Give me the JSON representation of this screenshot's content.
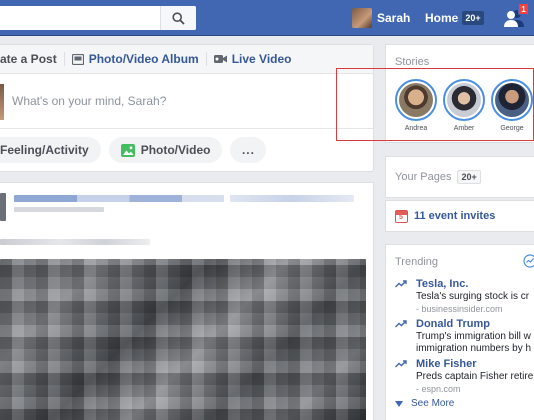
{
  "topbar": {
    "user_name": "Sarah",
    "home_label": "Home",
    "home_count": "20+",
    "friend_requests_count": "1"
  },
  "composer": {
    "tabs": [
      {
        "label": "ate a Post",
        "icon": "pencil-icon"
      },
      {
        "label": "Photo/Video Album",
        "icon": "album-icon"
      },
      {
        "label": "Live Video",
        "icon": "video-camera-icon"
      }
    ],
    "placeholder": "What's on your mind, Sarah?",
    "actions": [
      {
        "label": "Feeling/Activity"
      },
      {
        "label": "Photo/Video",
        "icon": "photo-icon"
      },
      {
        "label": "..."
      }
    ]
  },
  "stories": {
    "title": "Stories",
    "items": [
      {
        "name": "Andrea"
      },
      {
        "name": "Amber"
      },
      {
        "name": "George"
      }
    ]
  },
  "pages": {
    "label": "Your Pages",
    "count": "20+"
  },
  "events": {
    "label": "11 event invites"
  },
  "trending": {
    "title": "Trending",
    "items": [
      {
        "topic": "Tesla, Inc.",
        "desc": "Tesla's surging stock is cr",
        "source": "- businessinsider.com"
      },
      {
        "topic": "Donald Trump",
        "desc": "Trump's immigration bill w",
        "desc2": "immigration numbers by h"
      },
      {
        "topic": "Mike Fisher",
        "desc": "Preds captain Fisher retire",
        "source": "- espn.com"
      }
    ],
    "see_more": "See More"
  },
  "colors": {
    "brand_blue": "#4267b2",
    "link_blue": "#365899",
    "story_ring": "#4a90e2",
    "annotation_red": "#d93c3c",
    "notification_red": "#fa3e3e"
  }
}
